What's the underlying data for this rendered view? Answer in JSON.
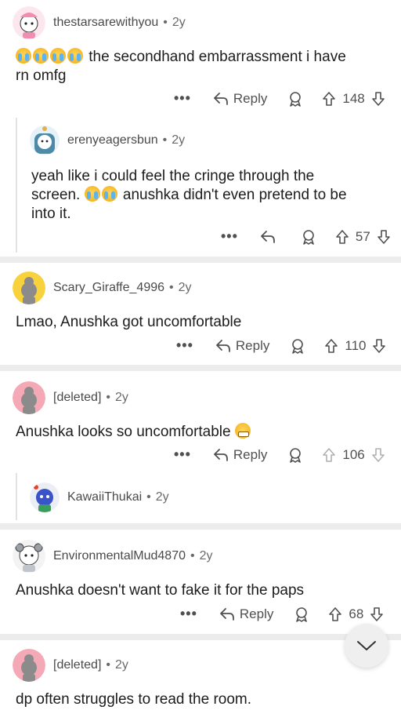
{
  "comments": [
    {
      "user": "thestarsarewithyou",
      "age": "2y",
      "text_after_emoji": "the secondhand embarrassment i have",
      "text_line2": "rn omfg",
      "reply_label": "Reply",
      "votes": "148"
    },
    {
      "user": "erenyeagersbun",
      "age": "2y",
      "text_line1": "yeah like i could feel the cringe through the",
      "text_line2_a": "screen.",
      "text_line2_b": "anushka didn't even pretend to be",
      "text_line3": "into it.",
      "votes": "57"
    },
    {
      "user": "Scary_Giraffe_4996",
      "age": "2y",
      "text": "Lmao, Anushka got uncomfortable",
      "reply_label": "Reply",
      "votes": "110"
    },
    {
      "user": "[deleted]",
      "age": "2y",
      "text": "Anushka looks so uncomfortable",
      "reply_label": "Reply",
      "votes": "106"
    },
    {
      "user": "KawaiiThukai",
      "age": "2y"
    },
    {
      "user": "EnvironmentalMud4870",
      "age": "2y",
      "text": "Anushka doesn't want to fake it for the paps",
      "reply_label": "Reply",
      "votes": "68"
    },
    {
      "user": "[deleted]",
      "age": "2y",
      "text": "dp often struggles to read the room."
    }
  ],
  "ui": {
    "more": "•••",
    "dot": "•"
  },
  "colors": {
    "separator": "#ececec",
    "text": "#1c1c1c",
    "meta": "#6a6a6a"
  },
  "icons": [
    "reply-arrow-icon",
    "award-icon",
    "upvote-icon",
    "downvote-icon",
    "chevron-down-icon"
  ]
}
